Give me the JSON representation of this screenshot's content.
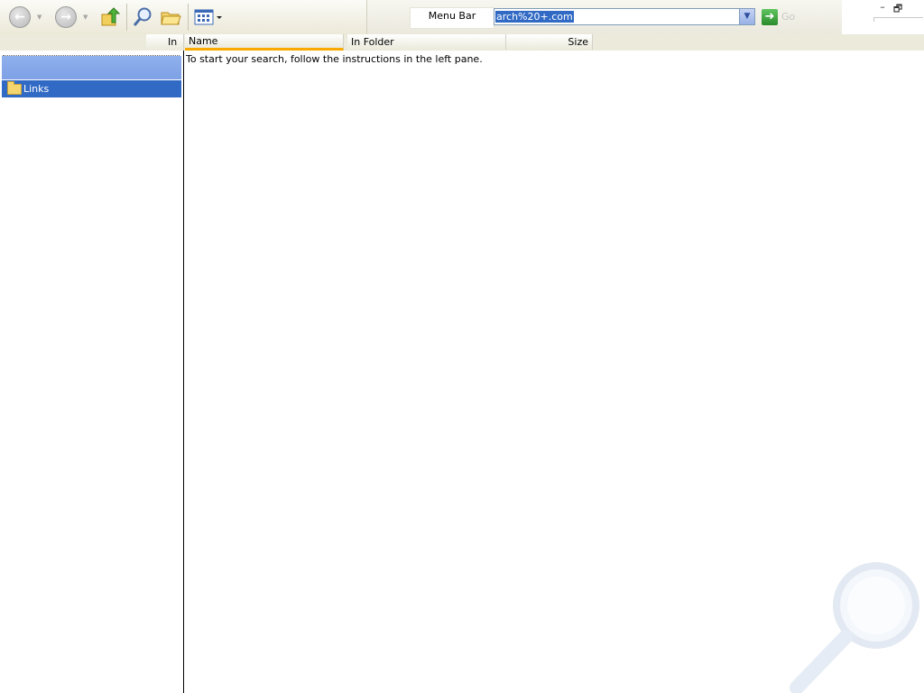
{
  "toolbar": {
    "buttons": [
      "back-icon",
      "forward-icon",
      "up-folder-icon",
      "search-icon",
      "folders-icon",
      "views-icon"
    ],
    "menubar_label": "Menu Bar",
    "address_value": "arch%20+.com",
    "go_label": "Go"
  },
  "window_controls": {
    "minimize": "–",
    "restore": "🗗"
  },
  "columns": {
    "left_header": "In F",
    "name": "Name",
    "in_folder": "In Folder",
    "size": "Size"
  },
  "left_pane": {
    "selected_item": "Links"
  },
  "right_pane": {
    "message": "To start your search, follow the instructions in the left pane."
  },
  "colors": {
    "selection": "#316ac5",
    "active_column_underline": "#f9a900"
  }
}
